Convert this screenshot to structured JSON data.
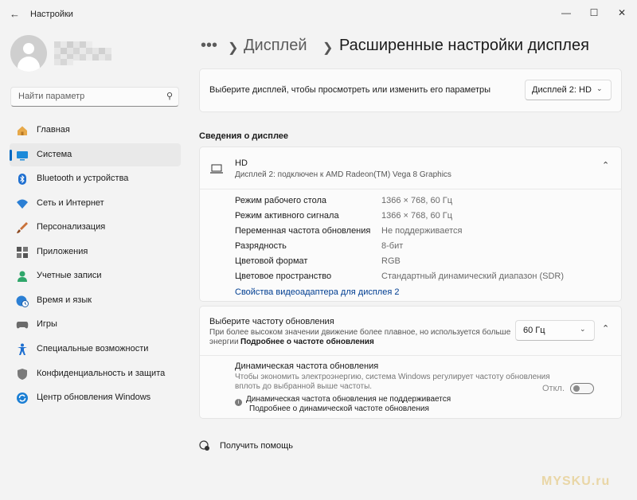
{
  "window": {
    "title": "Настройки"
  },
  "sidebar": {
    "search_placeholder": "Найти параметр",
    "items": [
      {
        "label": "Главная",
        "icon": "home-icon"
      },
      {
        "label": "Система",
        "icon": "system-icon",
        "selected": true
      },
      {
        "label": "Bluetooth и устройства",
        "icon": "bluetooth-icon"
      },
      {
        "label": "Сеть и Интернет",
        "icon": "wifi-icon"
      },
      {
        "label": "Персонализация",
        "icon": "brush-icon"
      },
      {
        "label": "Приложения",
        "icon": "apps-icon"
      },
      {
        "label": "Учетные записи",
        "icon": "person-icon"
      },
      {
        "label": "Время и язык",
        "icon": "globe-clock-icon"
      },
      {
        "label": "Игры",
        "icon": "gamepad-icon"
      },
      {
        "label": "Специальные возможности",
        "icon": "accessibility-icon"
      },
      {
        "label": "Конфиденциальность и защита",
        "icon": "shield-icon"
      },
      {
        "label": "Центр обновления Windows",
        "icon": "update-icon"
      }
    ]
  },
  "breadcrumb": {
    "ellipsis": "•••",
    "parent": "Дисплей",
    "current": "Расширенные настройки дисплея"
  },
  "select_display": {
    "label": "Выберите дисплей, чтобы просмотреть или изменить его параметры",
    "value": "Дисплей 2: HD"
  },
  "info": {
    "section_title": "Сведения о дисплее",
    "name": "HD",
    "subtitle": "Дисплей 2: подключен к AMD Radeon(TM) Vega 8 Graphics",
    "rows": [
      {
        "label": "Режим рабочего стола",
        "value": "1366 × 768, 60 Гц"
      },
      {
        "label": "Режим активного сигнала",
        "value": "1366 × 768, 60 Гц"
      },
      {
        "label": "Переменная частота обновления",
        "value": "Не поддерживается"
      },
      {
        "label": "Разрядность",
        "value": "8-бит"
      },
      {
        "label": "Цветовой формат",
        "value": "RGB"
      },
      {
        "label": "Цветовое пространство",
        "value": "Стандартный динамический диапазон (SDR)"
      }
    ],
    "adapter_link": "Свойства видеоадаптера для дисплея 2"
  },
  "refresh": {
    "title": "Выберите частоту обновления",
    "desc_line1": "При более высоком значении движение более плавное, но используется больше",
    "desc_line2": "энергии",
    "desc_link": "Подробнее о частоте обновления",
    "value": "60 Гц"
  },
  "dynamic": {
    "title": "Динамическая частота обновления",
    "desc_line1": "Чтобы экономить электроэнергию, система Windows регулирует частоту обновления",
    "desc_line2": "вплоть до выбранной выше частоты.",
    "notice": "Динамическая частота обновления не поддерживается",
    "link": "Подробнее о динамической частоте обновления",
    "toggle_label": "Откл.",
    "toggle_on": false
  },
  "help": {
    "label": "Получить помощь"
  },
  "watermark": "MYSKU.ru"
}
